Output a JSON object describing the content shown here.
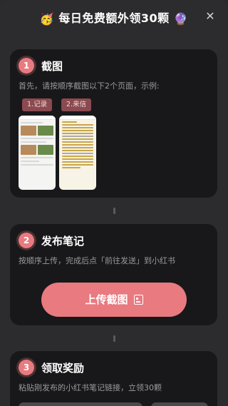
{
  "header": {
    "emoji_left": "🥳",
    "title": "每日免费额外领30颗",
    "emoji_right": "🔮",
    "close": "✕"
  },
  "steps": [
    {
      "number": "1",
      "title": "截图",
      "desc": "首先，请按顺序截图以下2个页面，示例:",
      "tags": [
        "1.记录",
        "2.来信"
      ]
    },
    {
      "number": "2",
      "title": "发布笔记",
      "desc": "按顺序上传，完成后点「前往发送」到小红书",
      "button": "上传截图"
    },
    {
      "number": "3",
      "title": "领取奖励",
      "desc": "粘贴刚发布的小红书笔记链接，立领30颗"
    }
  ],
  "colors": {
    "accent": "#e87a80",
    "card": "#18181a",
    "background": "#2c2c2e"
  }
}
